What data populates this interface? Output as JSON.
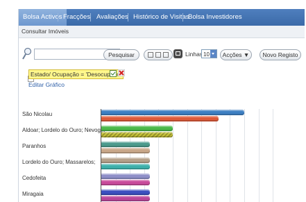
{
  "tabs": [
    {
      "label": "Bolsa Activos",
      "active": true
    },
    {
      "label": "Fracções",
      "active": false
    },
    {
      "label": "Avaliações",
      "active": false
    },
    {
      "label": "Histórico de Visitas",
      "active": false
    },
    {
      "label": "Bolsa Investidores",
      "active": false
    }
  ],
  "subnav": {
    "label": "Consultar Imóveis"
  },
  "toolbar": {
    "search_value": "",
    "search_button": "Pesquisar",
    "linhas_label": "Linhas",
    "linhas_value": "10",
    "acoes_button": "Acções ▼",
    "novo_button": "Novo Registo"
  },
  "filter": {
    "tag": "Estado/ Ocupação = 'Desocupado'",
    "edit_link": "Editar Gráfico",
    "expander": "⊟"
  },
  "chart_data": {
    "type": "bar",
    "orientation": "horizontal",
    "categories": [
      "São Nicolau",
      "Aldoar; Lordelo do Ouro; Nevog...",
      "Paranhos",
      "Lordelo do Ouro; Massarelos;",
      "Cedofeita",
      "Miragaia"
    ],
    "series": [
      {
        "values": [
          10.0,
          8.2
        ],
        "colors": [
          "#3d7fc2",
          "#de5b3a"
        ]
      },
      {
        "values": [
          5.0,
          5.0
        ],
        "colors": [
          "#4bb84a",
          "#c8c43a"
        ]
      },
      {
        "values": [
          3.4,
          3.4
        ],
        "colors": [
          "#4c9a8c",
          "#c9a88a"
        ]
      },
      {
        "values": [
          3.4,
          3.4
        ],
        "colors": [
          "#b4a08a",
          "#3fb1ac"
        ]
      },
      {
        "values": [
          3.4,
          3.4
        ],
        "colors": [
          "#8e8ec8",
          "#c94b9c"
        ]
      },
      {
        "values": [
          3.4,
          3.4
        ],
        "colors": [
          "#3b4fc0",
          "#b9479a"
        ]
      }
    ],
    "xlim": [
      0,
      13
    ],
    "grid": true
  }
}
